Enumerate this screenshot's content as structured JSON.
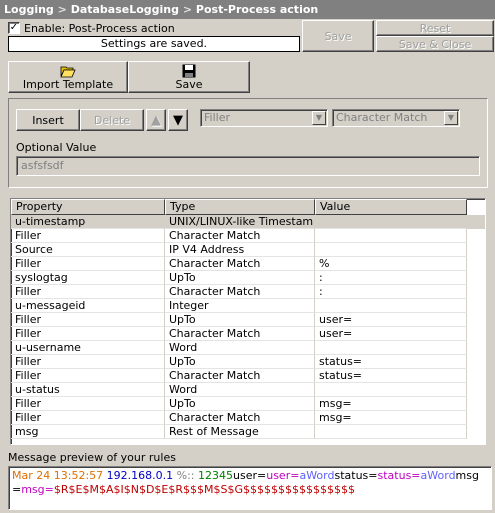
{
  "title": {
    "parts": [
      "Logging",
      "DatabaseLogging",
      "Post-Process action"
    ],
    "separator": " > "
  },
  "enable_label": "Enable: Post-Process action",
  "enable_checked": true,
  "status_text": "Settings are saved.",
  "buttons": {
    "save": "Save",
    "reset": "Reset",
    "save_close": "Save & Close"
  },
  "toolbar": {
    "import_template": "Import Template",
    "save": "Save"
  },
  "editor": {
    "insert": "Insert",
    "delete": "Delete",
    "type_value": "Filler",
    "match_value": "Character Match",
    "optional_value_label": "Optional Value",
    "optional_value": "asfsfsdf"
  },
  "table": {
    "headers": [
      "Property",
      "Type",
      "Value"
    ],
    "rows": [
      [
        "u-timestamp",
        "UNIX/LINUX-like Timestamp",
        ""
      ],
      [
        "Filler",
        "Character Match",
        ""
      ],
      [
        "Source",
        "IP V4 Address",
        ""
      ],
      [
        "Filler",
        "Character Match",
        "%"
      ],
      [
        "syslogtag",
        "UpTo",
        ":"
      ],
      [
        "Filler",
        "Character Match",
        ":"
      ],
      [
        "u-messageid",
        "Integer",
        ""
      ],
      [
        "Filler",
        "UpTo",
        "user="
      ],
      [
        "Filler",
        "Character Match",
        "user="
      ],
      [
        "u-username",
        "Word",
        ""
      ],
      [
        "Filler",
        "UpTo",
        "status="
      ],
      [
        "Filler",
        "Character Match",
        "status="
      ],
      [
        "u-status",
        "Word",
        ""
      ],
      [
        "Filler",
        "UpTo",
        "msg="
      ],
      [
        "Filler",
        "Character Match",
        "msg="
      ],
      [
        "msg",
        "Rest of Message",
        ""
      ]
    ]
  },
  "preview_label": "Message preview of your rules",
  "preview_segments": [
    {
      "text": "Mar 24 13:52:57 ",
      "color": "#e07000"
    },
    {
      "text": "192.168.0.1 ",
      "color": "#0000c0"
    },
    {
      "text": "%:: ",
      "color": "#808080"
    },
    {
      "text": "12345",
      "color": "#008000"
    },
    {
      "text": "user=",
      "color": "#000000"
    },
    {
      "text": "user=",
      "color": "#c000c0"
    },
    {
      "text": "aWord",
      "color": "#6060ff"
    },
    {
      "text": "status=",
      "color": "#000000"
    },
    {
      "text": "status=",
      "color": "#c000c0"
    },
    {
      "text": "aWord",
      "color": "#6060ff"
    },
    {
      "text": "msg=",
      "color": "#000000"
    },
    {
      "text": "msg=",
      "color": "#c000c0"
    },
    {
      "text": "$R$E$M$A$I$N$D$E$R$$$M$S$G$$$$$$$$$$$$$$$$",
      "color": "#c00000"
    }
  ],
  "colors": {
    "window_bg": "#d4d0c8",
    "title_bg": "#808080",
    "selected_row": "#d4d0c8"
  }
}
